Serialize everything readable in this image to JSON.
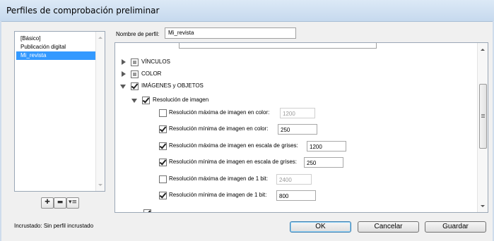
{
  "window": {
    "title": "Perfiles de comprobación preliminar"
  },
  "profiles": {
    "items": [
      {
        "label": "[Básico]",
        "selected": false
      },
      {
        "label": "Publicación digital",
        "selected": false
      },
      {
        "label": "Mi_revista",
        "selected": true
      }
    ],
    "buttons": {
      "add": "✚",
      "remove": "▬",
      "menu": "▾≡"
    }
  },
  "profile_name": {
    "label": "Nombre de perfil:",
    "value": "Mi_revista"
  },
  "tree": {
    "vinculos": {
      "label": "VÍNCULOS",
      "check": "mixed",
      "expanded": false
    },
    "color": {
      "label": "COLOR",
      "check": "mixed",
      "expanded": false
    },
    "imagenes": {
      "label": "IMÁGENES y OBJETOS",
      "check": "checked",
      "expanded": true
    },
    "resolucion": {
      "label": "Resolución de imagen",
      "check": "checked",
      "expanded": true
    },
    "settings": [
      {
        "label": "Resolución máxima de imagen en color:",
        "checked": false,
        "value": "1200"
      },
      {
        "label": "Resolución mínima de imagen en color:",
        "checked": true,
        "value": "250"
      },
      {
        "label": "Resolución máxima de imagen en escala de grises:",
        "checked": true,
        "value": "1200"
      },
      {
        "label": "Resolución mínima de imagen en escala de grises:",
        "checked": true,
        "value": "250"
      },
      {
        "label": "Resolución máxima de imagen de 1 bit:",
        "checked": false,
        "value": "2400"
      },
      {
        "label": "Resolución mínima de imagen de 1 bit:",
        "checked": true,
        "value": "800"
      }
    ]
  },
  "status": {
    "embedded_label": "Incrustado:",
    "embedded_value": "Sin perfil incrustado"
  },
  "actions": {
    "ok": "OK",
    "cancel": "Cancelar",
    "save": "Guardar"
  }
}
